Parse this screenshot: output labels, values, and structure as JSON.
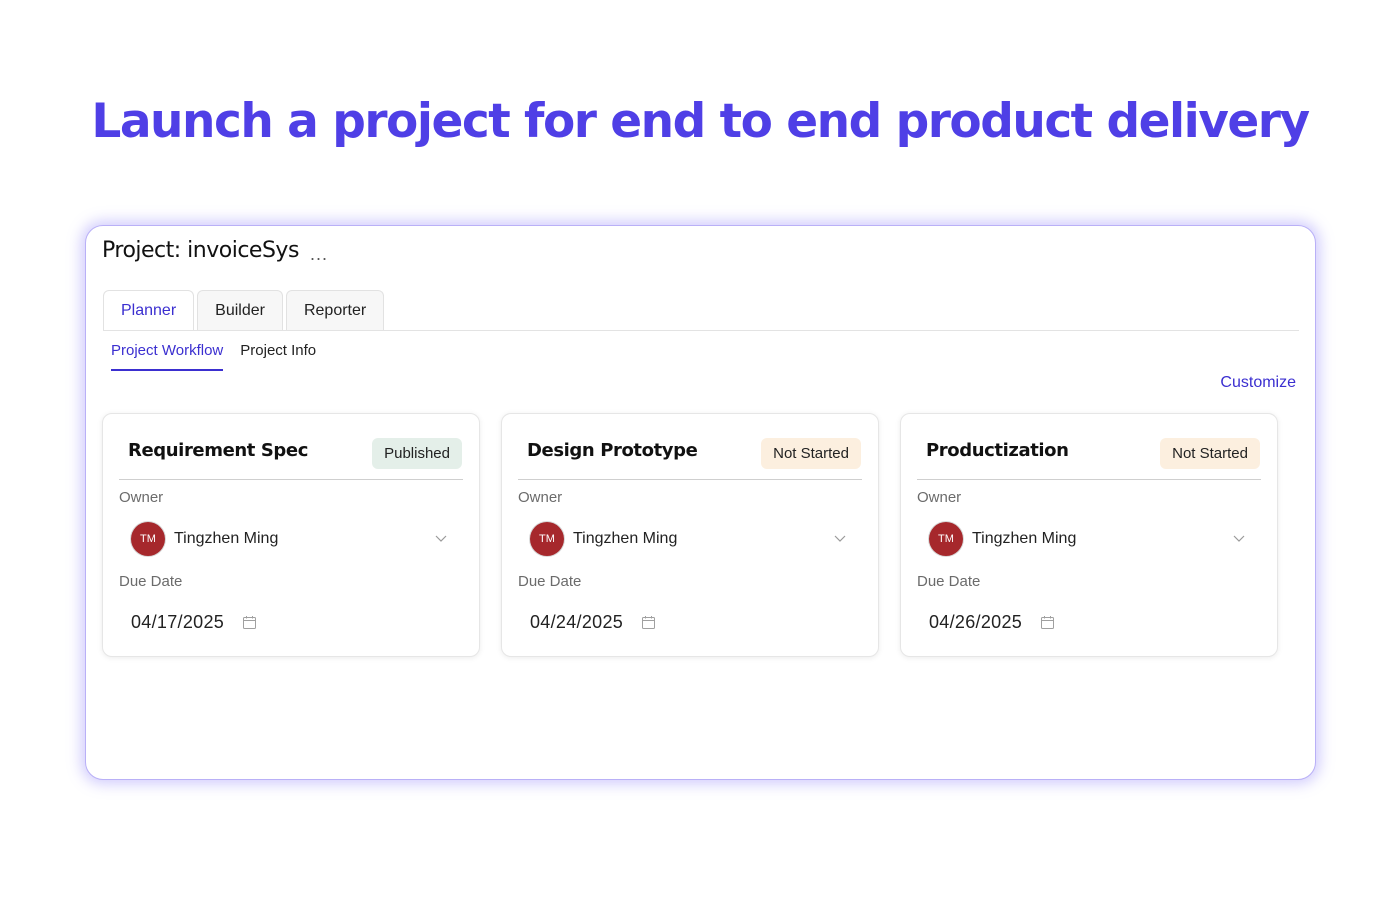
{
  "headline": "Launch a project for end to end product delivery",
  "project": {
    "title": "Project: invoiceSys",
    "more_label": "..."
  },
  "tabs": [
    {
      "label": "Planner",
      "active": true
    },
    {
      "label": "Builder",
      "active": false
    },
    {
      "label": "Reporter",
      "active": false
    }
  ],
  "subtabs": [
    {
      "label": "Project Workflow",
      "active": true
    },
    {
      "label": "Project Info",
      "active": false
    }
  ],
  "customize_label": "Customize",
  "cards": [
    {
      "title": "Requirement Spec",
      "status": "Published",
      "owner_label": "Owner",
      "owner_initials": "TM",
      "owner_name": "Tingzhen Ming",
      "due_label": "Due Date",
      "due_date": "04/17/2025"
    },
    {
      "title": "Design Prototype",
      "status": "Not Started",
      "owner_label": "Owner",
      "owner_initials": "TM",
      "owner_name": "Tingzhen Ming",
      "due_label": "Due Date",
      "due_date": "04/24/2025"
    },
    {
      "title": "Productization",
      "status": "Not Started",
      "owner_label": "Owner",
      "owner_initials": "TM",
      "owner_name": "Tingzhen Ming",
      "due_label": "Due Date",
      "due_date": "04/26/2025"
    }
  ],
  "colors": {
    "accent": "#4f3fe6",
    "link": "#3b2fd0",
    "avatar": "#a6282c",
    "badge_published": "#e4efe9",
    "badge_not_started": "#fcefdf"
  },
  "icons": {
    "more": "more-horizontal-icon",
    "chevron": "chevron-down-icon",
    "calendar": "calendar-icon"
  }
}
